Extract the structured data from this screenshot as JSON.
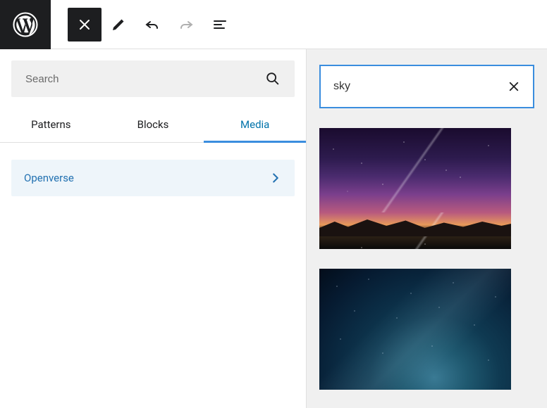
{
  "left": {
    "search": {
      "placeholder": "Search",
      "value": ""
    },
    "tabs": {
      "patterns": "Patterns",
      "blocks": "Blocks",
      "media": "Media",
      "active": "media"
    },
    "categories": [
      {
        "label": "Openverse"
      }
    ]
  },
  "right": {
    "search": {
      "value": "sky"
    }
  }
}
